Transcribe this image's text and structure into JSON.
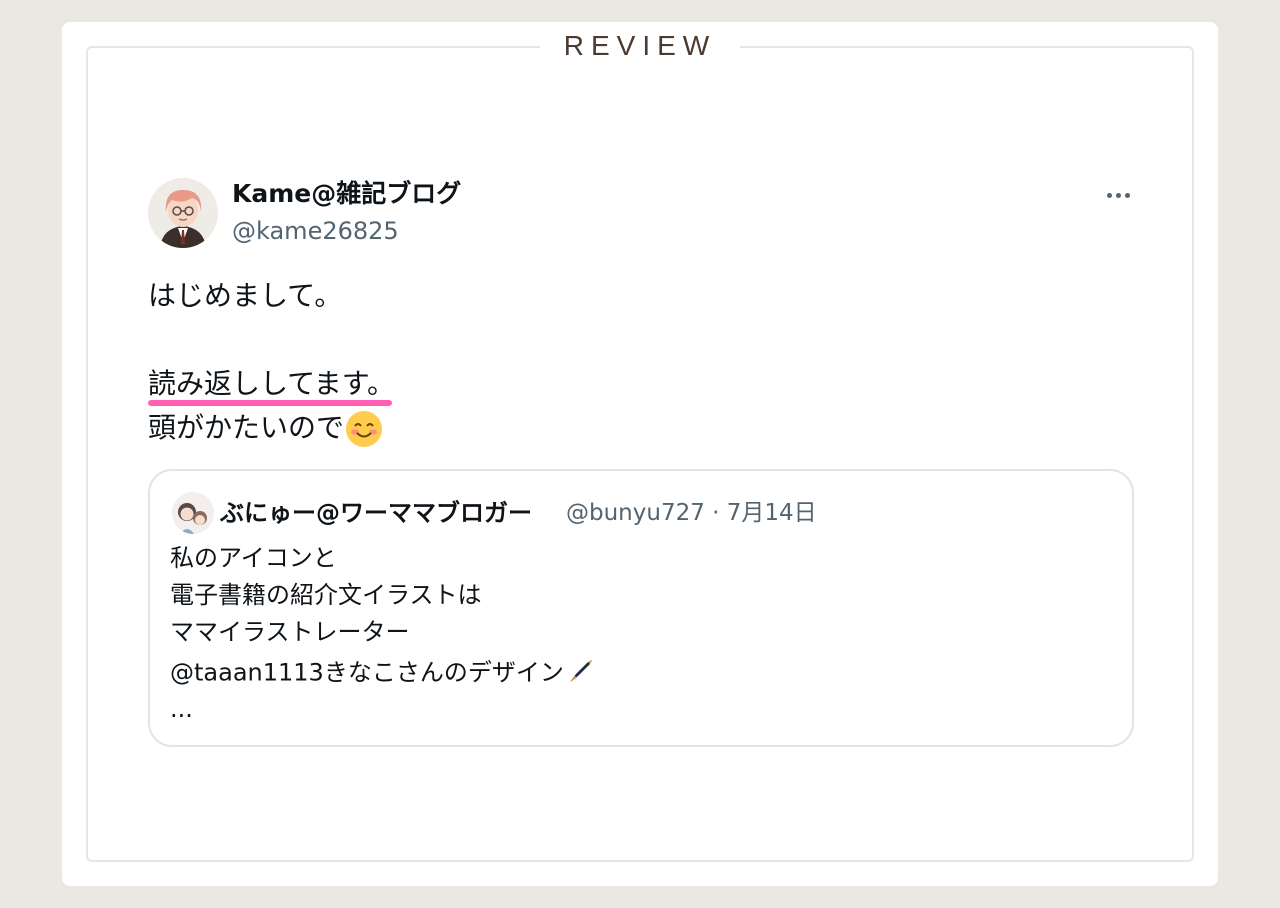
{
  "section_title": "REVIEW",
  "tweet": {
    "author_name": "Kame@雑記ブログ",
    "author_handle": "@kame26825",
    "text_line1": "はじめまして。",
    "text_line2": "読み返ししてます。",
    "text_line3": "頭がかたいので",
    "underline_color": "#ff5fb4"
  },
  "quoted": {
    "author_name": "ぶにゅー@ワーママブロガー",
    "meta": "@bunyu727 · 7月14日",
    "line1": "私のアイコンと",
    "line2": "電子書籍の紹介文イラストは",
    "line3": "ママイラストレーター",
    "line4": " @taaan1113きなこさんのデザイン",
    "line5": "..."
  },
  "colors": {
    "background": "#ebe7e3",
    "card": "#ffffff",
    "handle_gray": "#536471",
    "title_brown": "#4a3a30"
  }
}
